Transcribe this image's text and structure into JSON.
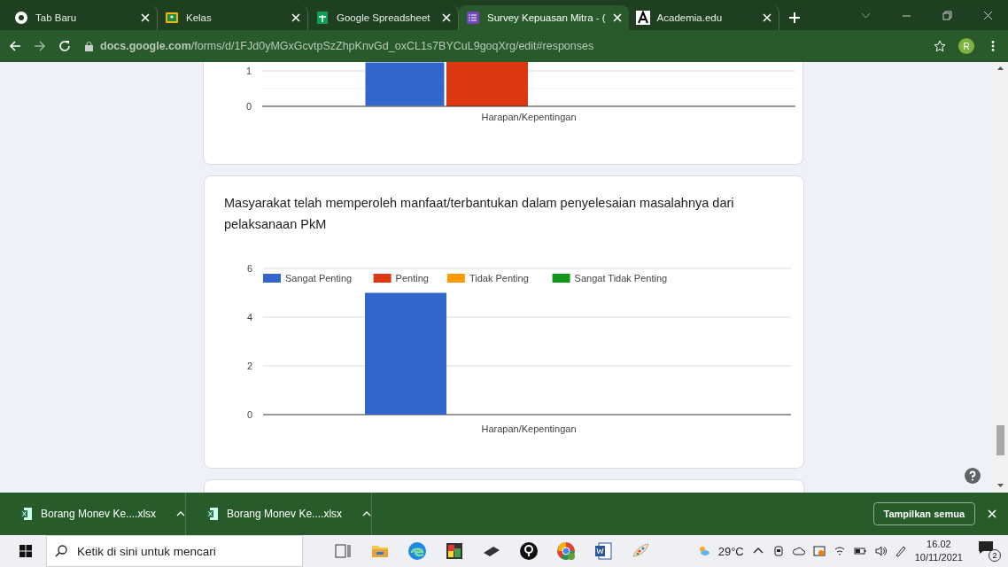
{
  "tabs": [
    {
      "title": "Tab Baru",
      "selected": false
    },
    {
      "title": "Kelas",
      "selected": false
    },
    {
      "title": "Google Spreadsheet",
      "selected": false
    },
    {
      "title": "Survey Kepuasan Mitra - (",
      "selected": true
    },
    {
      "title": "Academia.edu",
      "selected": false
    }
  ],
  "address_bar": {
    "url": "**docs.google.com**/forms/d/1FJd0yMGxGcvtpSzZhpKnvGd_oxCL1s7BYCuL9goqXrg/edit#responses",
    "avatar": "R"
  },
  "cards": [
    {
      "kind": "fragment",
      "y_labels": [
        "1",
        "0"
      ],
      "xlabel": "Harapan/Kepentingan"
    },
    {
      "kind": "question",
      "question": "Masyarakat telah memperoleh manfaat/terbantukan dalam penyelesaian masalahnya dari pelaksanaan PkM",
      "chart_data": {
        "type": "bar",
        "categories": [
          "Harapan/Kepentingan"
        ],
        "yticks": [
          0,
          2,
          4,
          6
        ],
        "ylim": [
          0,
          6
        ],
        "series": [
          {
            "name": "Sangat Penting",
            "color": "#3366cc",
            "values": [
              5
            ]
          },
          {
            "name": "Penting",
            "color": "#dc3912",
            "values": [
              0
            ]
          },
          {
            "name": "Tidak Penting",
            "color": "#ff9900",
            "values": [
              0
            ]
          },
          {
            "name": "Sangat Tidak Penting",
            "color": "#109618",
            "values": [
              0
            ]
          }
        ]
      }
    }
  ],
  "downloads": [
    {
      "name": "Borang Monev Ke....xlsx"
    },
    {
      "name": "Borang Monev Ke....xlsx"
    }
  ],
  "show_all_button": "Tampilkan semua",
  "taskbar": {
    "search_placeholder": "Ketik di sini untuk mencari",
    "temperature": "29°C",
    "time": "16.02",
    "date": "10/11/2021",
    "notifications": "2"
  }
}
